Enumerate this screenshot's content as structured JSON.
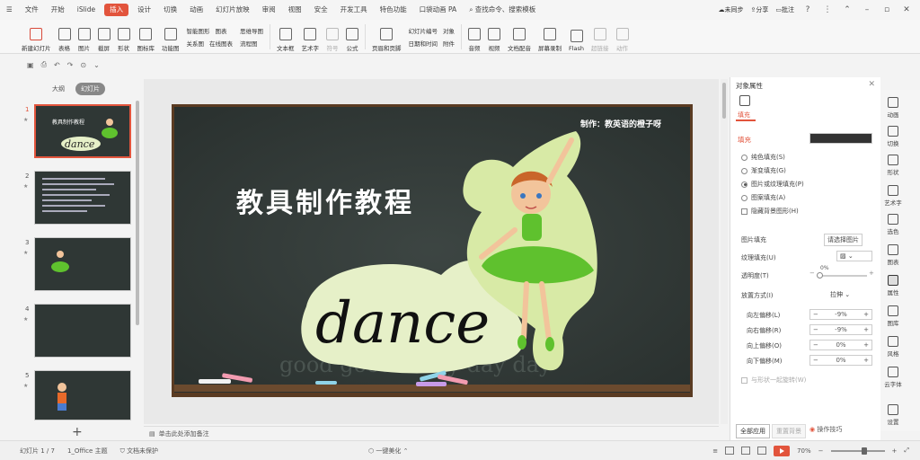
{
  "menu": {
    "items": [
      "文件",
      "开始",
      "iSlide",
      "插入",
      "设计",
      "切换",
      "动画",
      "幻灯片放映",
      "审阅",
      "视图",
      "安全",
      "开发工具",
      "特色功能",
      "口袋动画 PA"
    ],
    "active": "插入",
    "search_placeholder": "查找命令、搜索模板",
    "sync": "未同步",
    "share": "分享",
    "comment": "批注"
  },
  "ribbon": {
    "new_slide": "新建幻灯片",
    "table": "表格",
    "image": "图片",
    "screenshot": "截屏",
    "shape": "形状",
    "icon_lib": "图标库",
    "func_chart": "功能图",
    "smart_graphic": "智能图形",
    "chart": "图表",
    "mindmap": "思维导图",
    "relation": "关系图",
    "online_flow": "在线图表",
    "flowchart": "流程图",
    "textbox": "文本框",
    "art_text": "艺术字",
    "symbol": "符号",
    "formula": "公式",
    "header_footer": "页眉和页脚",
    "slide_number": "幻灯片编号",
    "object": "对象",
    "date_time": "日期和时间",
    "attachment": "附件",
    "audio": "音频",
    "video": "视频",
    "dub": "文档配音",
    "screen_rec": "屏幕录制",
    "flash": "Flash",
    "hyperlink": "超链接",
    "action": "动作"
  },
  "panel": {
    "tab_outline": "大纲",
    "tab_slides": "幻灯片",
    "thumbs": [
      {
        "num": "1",
        "selected": true
      },
      {
        "num": "2",
        "selected": false
      },
      {
        "num": "3",
        "selected": false
      },
      {
        "num": "4",
        "selected": false
      },
      {
        "num": "5",
        "selected": false
      }
    ]
  },
  "slide": {
    "credit": "制作：教英语的橙子呀",
    "title": "教具制作教程",
    "word": "dance",
    "faint_text": "good good study day day"
  },
  "notes": {
    "placeholder": "单击此处添加备注"
  },
  "props": {
    "title": "对象属性",
    "tab": "填充",
    "fill_label": "填充",
    "options": [
      "纯色填充(S)",
      "渐变填充(G)",
      "图片或纹理填充(P)",
      "图案填充(A)"
    ],
    "selected_option": 2,
    "hide_bg": "隐藏背景图形(H)",
    "picture_fill": "图片填充",
    "picture_fill_value": "请选择图片",
    "texture_fill": "纹理填充(U)",
    "transparency": "透明度(T)",
    "transparency_value": "0%",
    "placement": "放置方式(I)",
    "placement_value": "拉伸",
    "offsets": [
      {
        "label": "向左偏移(L)",
        "value": "-9%"
      },
      {
        "label": "向右偏移(R)",
        "value": "-9%"
      },
      {
        "label": "向上偏移(O)",
        "value": "0%"
      },
      {
        "label": "向下偏移(M)",
        "value": "0%"
      }
    ],
    "rotate_with_shape": "与形状一起旋转(W)",
    "apply_all": "全部应用",
    "reset_bg": "重置背景",
    "tips": "操作技巧"
  },
  "sidebar": [
    "动画",
    "切换",
    "形状",
    "艺术字",
    "选色",
    "图表",
    "属性",
    "图库",
    "风格",
    "云字体",
    "设置"
  ],
  "status": {
    "slide_info": "幻灯片 1 / 7",
    "theme": "1_Office 主题",
    "protect": "文档未保护",
    "beautify": "一键美化",
    "zoom": "70%"
  },
  "colors": {
    "accent": "#e2543c",
    "chalkboard": "#2f3735",
    "green": "#5fc12e"
  }
}
